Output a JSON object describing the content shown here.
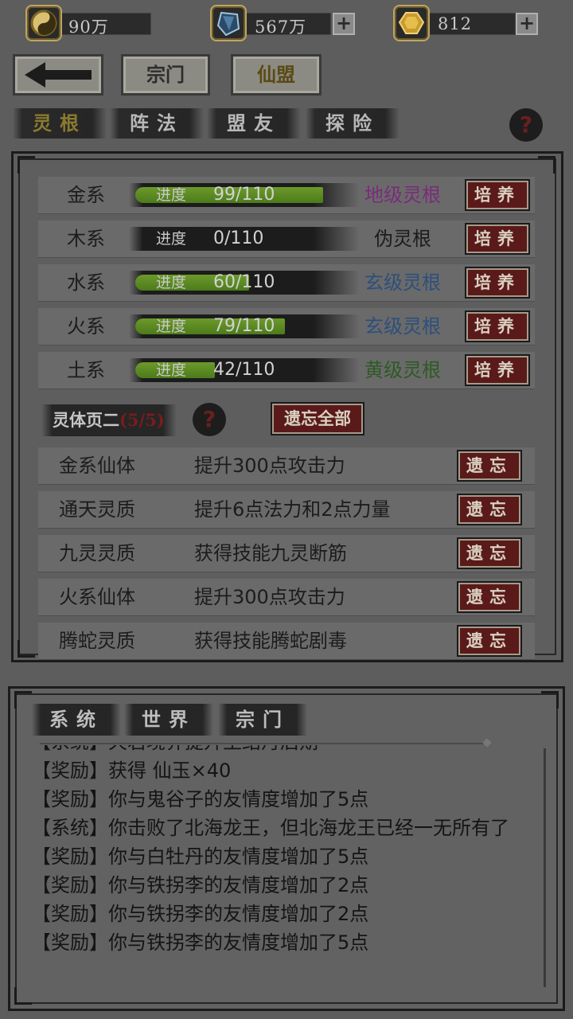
{
  "resources": [
    {
      "icon": "yin-yang-coin-icon",
      "value": "90万",
      "has_plus": false
    },
    {
      "icon": "blue-crystal-icon",
      "value": "567万",
      "has_plus": true
    },
    {
      "icon": "gold-jade-icon",
      "value": "812",
      "has_plus": true
    }
  ],
  "nav": {
    "back": "←",
    "sect": "宗门",
    "alliance": "仙盟"
  },
  "tabs": [
    "灵根",
    "阵法",
    "盟友",
    "探险"
  ],
  "help": "?",
  "roots": [
    {
      "name": "金系",
      "label": "进度",
      "progress": "99/110",
      "pct": 0.9,
      "grade": "地级灵根",
      "grade_color": "#7a2c7a",
      "button": "培养"
    },
    {
      "name": "木系",
      "label": "进度",
      "progress": "0/110",
      "pct": 0,
      "grade": "伪灵根",
      "grade_color": "#1c1c1c",
      "button": "培养"
    },
    {
      "name": "水系",
      "label": "进度",
      "progress": "60/110",
      "pct": 0.545,
      "grade": "玄级灵根",
      "grade_color": "#2d4f7c",
      "button": "培养"
    },
    {
      "name": "火系",
      "label": "进度",
      "progress": "79/110",
      "pct": 0.718,
      "grade": "玄级灵根",
      "grade_color": "#2d4f7c",
      "button": "培养"
    },
    {
      "name": "土系",
      "label": "进度",
      "progress": "42/110",
      "pct": 0.382,
      "grade": "黄级灵根",
      "grade_color": "#2e5a24",
      "button": "培养"
    }
  ],
  "section": {
    "title": "灵体页二",
    "count": "(5/5)",
    "forget_all": "遗忘全部"
  },
  "traits": [
    {
      "name": "金系仙体",
      "desc": "提升300点攻击力",
      "button": "遗忘"
    },
    {
      "name": "通天灵质",
      "desc": "提升6点法力和2点力量",
      "button": "遗忘"
    },
    {
      "name": "九灵灵质",
      "desc": "获得技能九灵断筋",
      "button": "遗忘"
    },
    {
      "name": "火系仙体",
      "desc": "提升300点攻击力",
      "button": "遗忘"
    },
    {
      "name": "腾蛇灵质",
      "desc": "获得技能腾蛇剧毒",
      "button": "遗忘"
    }
  ],
  "chat": {
    "tabs": [
      "系统",
      "世界",
      "宗门"
    ],
    "lines": [
      "【系统】天君境界提升至结丹后期",
      "【奖励】获得 仙玉×40",
      "【奖励】你与鬼谷子的友情度增加了5点",
      "【系统】你击败了北海龙王，但北海龙王已经一无所有了",
      "【奖励】你与白牡丹的友情度增加了5点",
      "【奖励】你与铁拐李的友情度增加了2点",
      "【奖励】你与铁拐李的友情度增加了2点",
      "【奖励】你与铁拐李的友情度增加了5点"
    ]
  }
}
